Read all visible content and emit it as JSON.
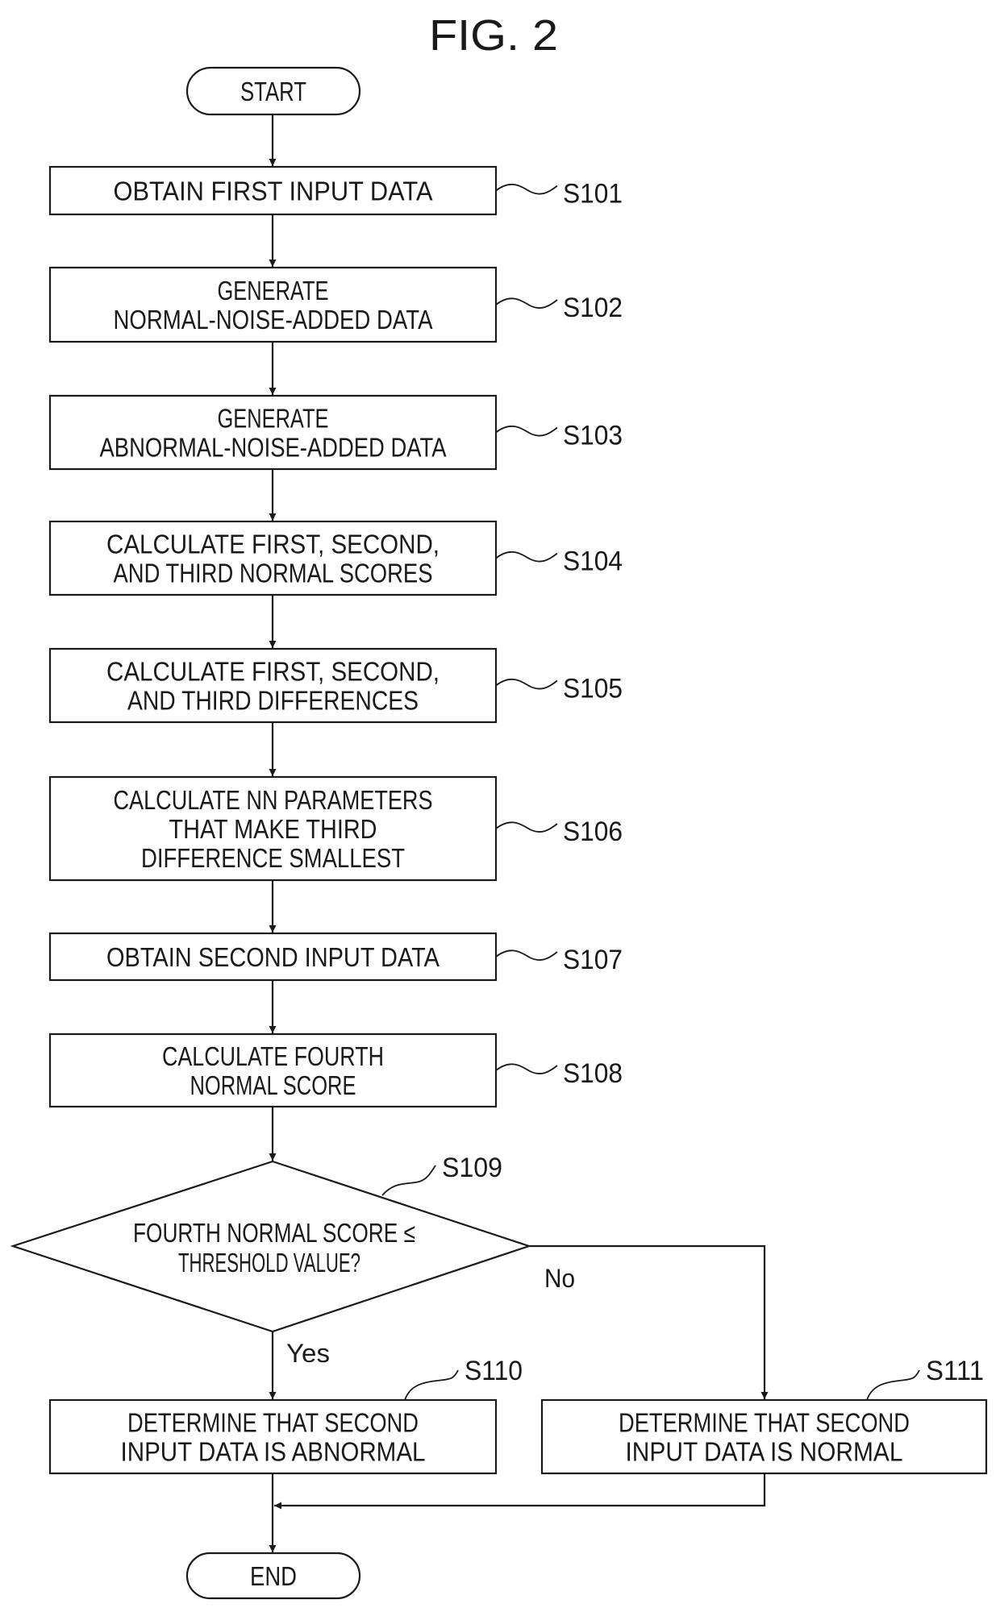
{
  "title": "FIG. 2",
  "flowchart": {
    "start": "START",
    "end": "END",
    "steps": [
      {
        "id": "S101",
        "lines": [
          "OBTAIN FIRST INPUT DATA"
        ]
      },
      {
        "id": "S102",
        "lines": [
          "GENERATE",
          "NORMAL-NOISE-ADDED DATA"
        ]
      },
      {
        "id": "S103",
        "lines": [
          "GENERATE",
          "ABNORMAL-NOISE-ADDED DATA"
        ]
      },
      {
        "id": "S104",
        "lines": [
          "CALCULATE FIRST, SECOND,",
          "AND THIRD NORMAL SCORES"
        ]
      },
      {
        "id": "S105",
        "lines": [
          "CALCULATE FIRST, SECOND,",
          "AND THIRD DIFFERENCES"
        ]
      },
      {
        "id": "S106",
        "lines": [
          "CALCULATE NN PARAMETERS",
          "THAT MAKE THIRD",
          "DIFFERENCE SMALLEST"
        ]
      },
      {
        "id": "S107",
        "lines": [
          "OBTAIN SECOND INPUT DATA"
        ]
      },
      {
        "id": "S108",
        "lines": [
          "CALCULATE FOURTH",
          "NORMAL SCORE"
        ]
      }
    ],
    "decision": {
      "id": "S109",
      "lines": [
        "FOURTH NORMAL SCORE ≤",
        "THRESHOLD VALUE?"
      ],
      "yes_label": "Yes",
      "no_label": "No"
    },
    "outcomes": [
      {
        "id": "S110",
        "branch": "Yes",
        "lines": [
          "DETERMINE THAT SECOND",
          "INPUT DATA IS ABNORMAL"
        ]
      },
      {
        "id": "S111",
        "branch": "No",
        "lines": [
          "DETERMINE THAT SECOND",
          "INPUT DATA IS NORMAL"
        ]
      }
    ]
  }
}
